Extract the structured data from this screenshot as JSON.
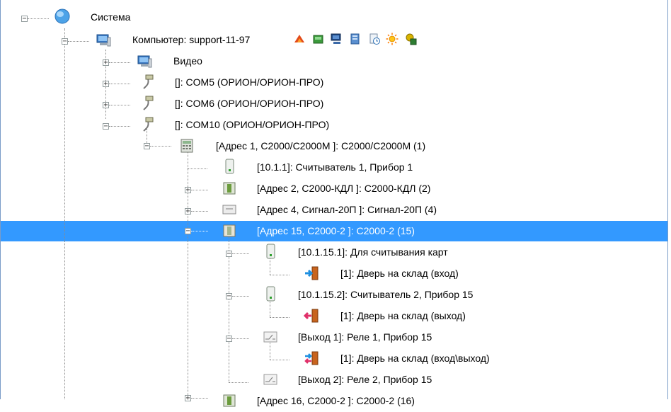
{
  "tree": {
    "items": [
      {
        "label": "Система",
        "icon": "globe-icon"
      },
      {
        "label": "Компьютер: support-11-97",
        "icon": "computer-icon",
        "toolbar_icons": [
          "dial-icon",
          "green-box-icon",
          "network-computer-icon",
          "server-icon",
          "doc-clock-icon",
          "sun-icon",
          "gear-db-icon"
        ]
      },
      {
        "label": "Видео",
        "icon": "computer-icon"
      },
      {
        "label": "[]: COM5 (ОРИОН/ОРИОН-ПРО)",
        "icon": "serial-cable-icon"
      },
      {
        "label": "[]: COM6 (ОРИОН/ОРИОН-ПРО)",
        "icon": "serial-cable-icon"
      },
      {
        "label": "[]: COM10 (ОРИОН/ОРИОН-ПРО)",
        "icon": "serial-cable-icon"
      },
      {
        "label": "[Адрес 1, С2000/С2000М ]: С2000/С2000М (1)",
        "icon": "keypad-controller-icon"
      },
      {
        "label": "[10.1.1]: Считыватель 1, Прибор 1",
        "icon": "reader-icon"
      },
      {
        "label": "[Адрес 2, С2000-КДЛ ]: С2000-КДЛ (2)",
        "icon": "device-icon"
      },
      {
        "label": "[Адрес 4, Сигнал-20П ]: Сигнал-20П (4)",
        "icon": "panel-icon"
      },
      {
        "label": "[Адрес 15, С2000-2 ]: С2000-2 (15)",
        "icon": "device-icon"
      },
      {
        "label": "[10.1.15.1]: Для считывания карт",
        "icon": "reader-icon"
      },
      {
        "label": "[1]: Дверь  на склад (вход)",
        "icon": "door-enter-icon"
      },
      {
        "label": "[10.1.15.2]: Считыватель 2, Прибор 15",
        "icon": "reader-icon"
      },
      {
        "label": "[1]: Дверь  на склад (выход)",
        "icon": "door-exit-icon"
      },
      {
        "label": "[Выход 1]: Реле 1, Прибор 15",
        "icon": "relay-icon"
      },
      {
        "label": "[1]: Дверь  на склад (вход\\выход)",
        "icon": "door-both-icon"
      },
      {
        "label": "[Выход 2]: Реле 2, Прибор 15",
        "icon": "relay-icon"
      },
      {
        "label": "[Адрес 16, С2000-2 ]: С2000-2 (16)",
        "icon": "device-icon"
      }
    ]
  }
}
